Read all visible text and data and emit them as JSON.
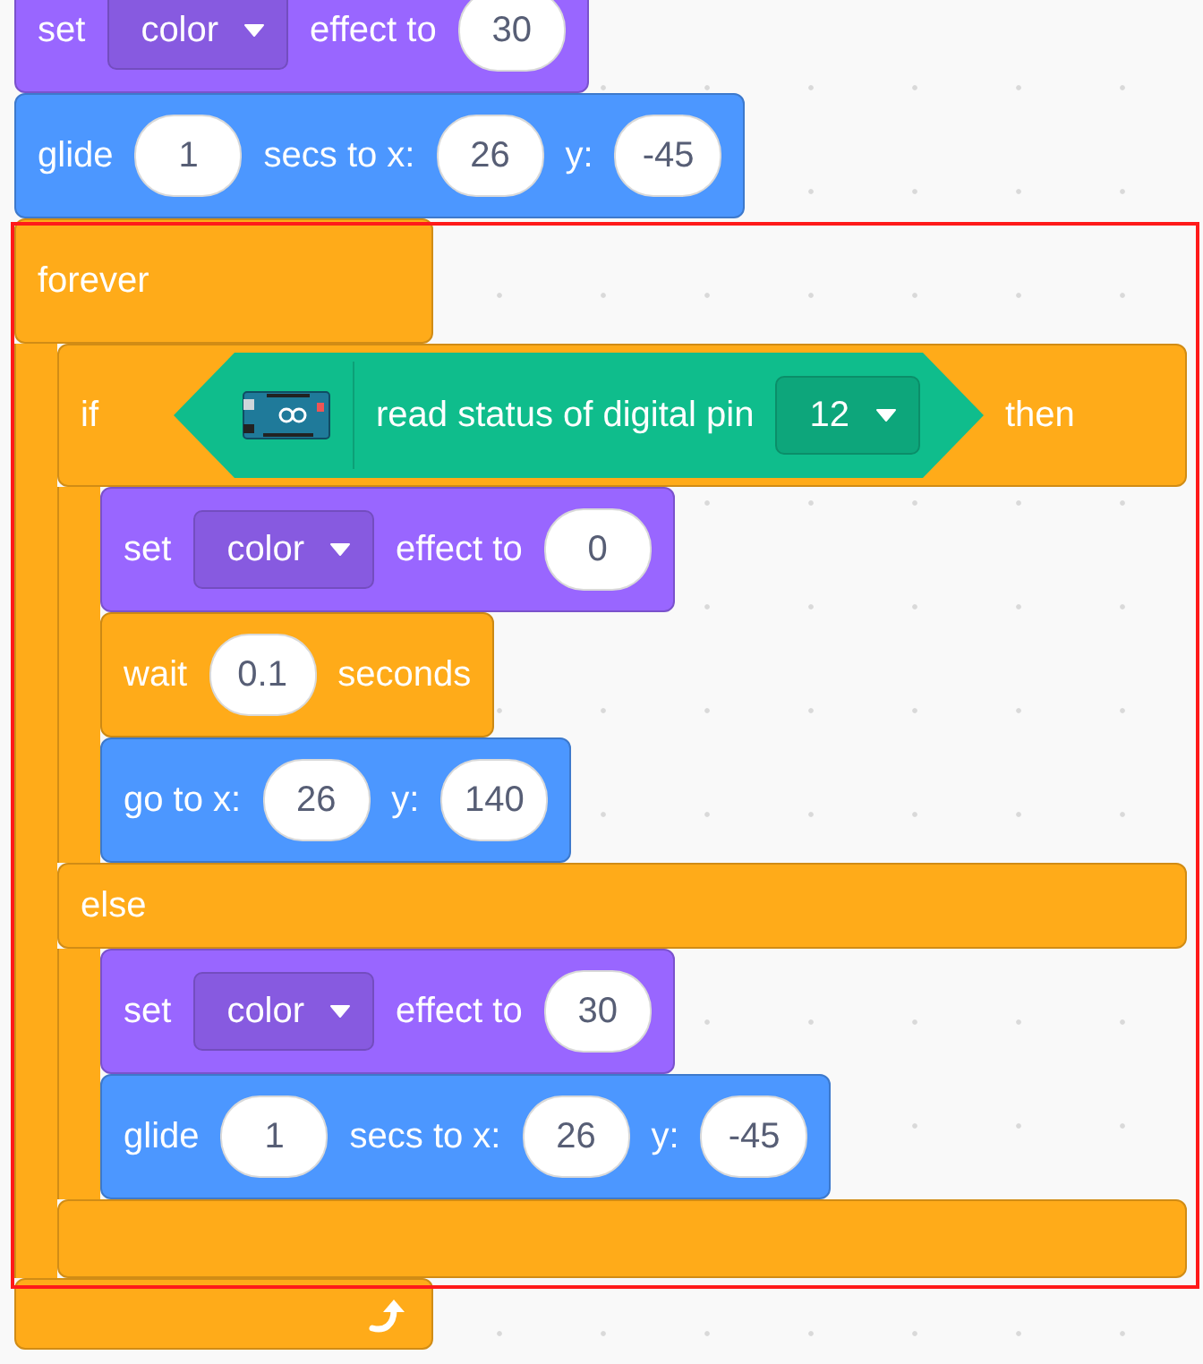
{
  "script": [
    {
      "color": "#9966ff",
      "parts": [
        {
          "kind": "label",
          "text": "set"
        },
        {
          "kind": "dropdown",
          "text": "color"
        },
        {
          "kind": "label",
          "text": "effect to"
        },
        {
          "kind": "number",
          "text": "30"
        }
      ]
    },
    {
      "color": "#4c97ff",
      "parts": [
        {
          "kind": "label",
          "text": "glide"
        },
        {
          "kind": "number",
          "text": "1"
        },
        {
          "kind": "label",
          "text": "secs to x:"
        },
        {
          "kind": "number",
          "text": "26"
        },
        {
          "kind": "label",
          "text": "y:"
        },
        {
          "kind": "number",
          "text": "-45"
        }
      ]
    },
    {
      "color": "#ffab19",
      "kind": "forever",
      "label": "forever",
      "selected": true,
      "children": [
        {
          "color": "#ffab19",
          "kind": "if_else",
          "if_label": "if",
          "then_label": "then",
          "else_label": "else",
          "condition": {
            "color": "#0fbd8c",
            "parts": [
              {
                "kind": "label",
                "text": "read status of digital pin"
              },
              {
                "kind": "dropdown",
                "text": "12"
              }
            ]
          },
          "children": [
            {
              "color": "#9966ff",
              "parts": [
                {
                  "kind": "label",
                  "text": "set"
                },
                {
                  "kind": "dropdown",
                  "text": "color"
                },
                {
                  "kind": "label",
                  "text": "effect to"
                },
                {
                  "kind": "number",
                  "text": "0"
                }
              ]
            },
            {
              "color": "#ffab19",
              "parts": [
                {
                  "kind": "label",
                  "text": "wait"
                },
                {
                  "kind": "number",
                  "text": "0.1"
                },
                {
                  "kind": "label",
                  "text": "seconds"
                }
              ]
            },
            {
              "color": "#4c97ff",
              "parts": [
                {
                  "kind": "label",
                  "text": "go to x:"
                },
                {
                  "kind": "number",
                  "text": "26"
                },
                {
                  "kind": "label",
                  "text": "y:"
                },
                {
                  "kind": "number",
                  "text": "140"
                }
              ]
            }
          ],
          "else_children": [
            {
              "color": "#9966ff",
              "parts": [
                {
                  "kind": "label",
                  "text": "set"
                },
                {
                  "kind": "dropdown",
                  "text": "color"
                },
                {
                  "kind": "label",
                  "text": "effect to"
                },
                {
                  "kind": "number",
                  "text": "30"
                }
              ]
            },
            {
              "color": "#4c97ff",
              "parts": [
                {
                  "kind": "label",
                  "text": "glide"
                },
                {
                  "kind": "number",
                  "text": "1"
                },
                {
                  "kind": "label",
                  "text": "secs to x:"
                },
                {
                  "kind": "number",
                  "text": "26"
                },
                {
                  "kind": "label",
                  "text": "y:"
                },
                {
                  "kind": "number",
                  "text": "-45"
                }
              ]
            }
          ]
        }
      ]
    }
  ]
}
